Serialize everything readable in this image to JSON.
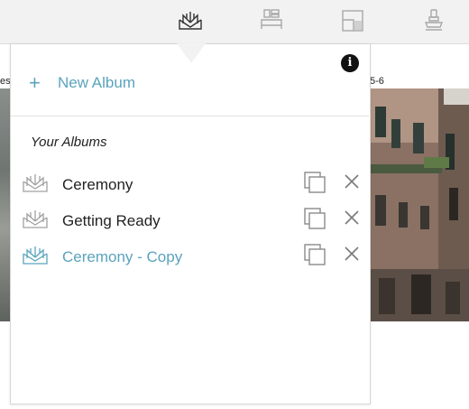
{
  "toolbar": {
    "buttons": [
      {
        "icon": "album-book-icon",
        "active": true
      },
      {
        "icon": "layout-grid-icon",
        "active": false
      },
      {
        "icon": "page-layout-icon",
        "active": false
      },
      {
        "icon": "stamp-icon",
        "active": false
      }
    ]
  },
  "background": {
    "left_label": "es",
    "right_label": "5-6"
  },
  "popover": {
    "info_icon": "info-icon",
    "info_text": "i",
    "new_album_plus": "+",
    "new_album_label": "New Album",
    "section_title": "Your Albums",
    "albums": [
      {
        "name": "Ceremony",
        "active": false
      },
      {
        "name": "Getting Ready",
        "active": false
      },
      {
        "name": "Ceremony - Copy",
        "active": true
      }
    ]
  },
  "colors": {
    "accent": "#5aa3bd",
    "text": "#222222",
    "icon_gray": "#9a9a9a",
    "toolbar_bg": "#f2f2f2"
  }
}
